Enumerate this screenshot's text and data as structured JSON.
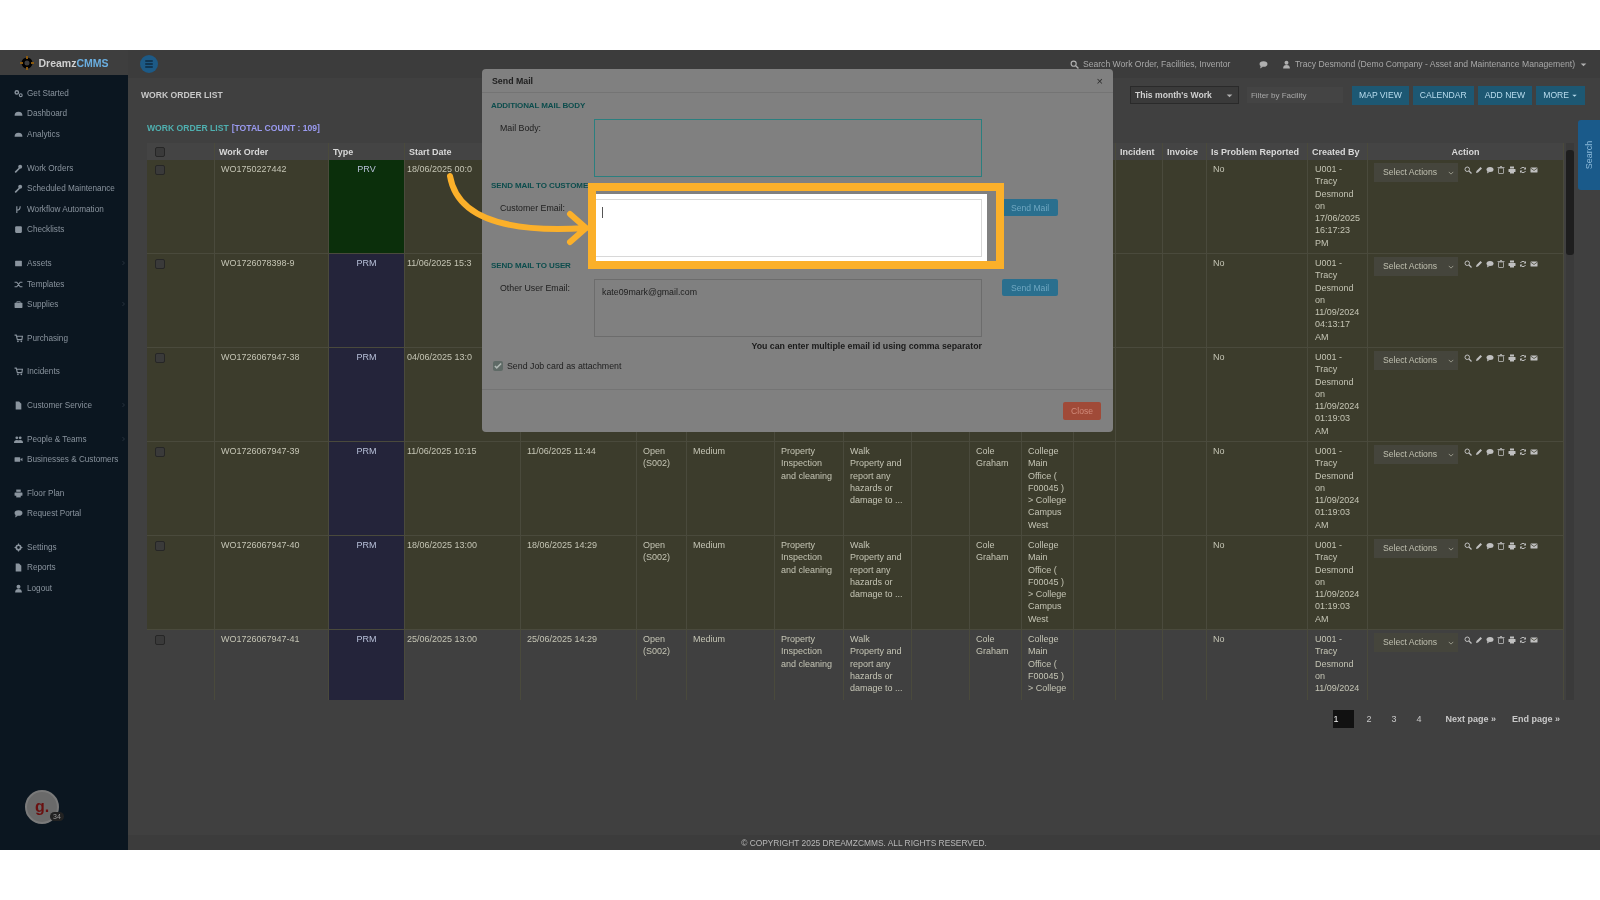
{
  "sidebar": {
    "logo": {
      "name": "Dreamz",
      "suffix": "CMMS"
    },
    "groups": [
      {
        "items": [
          {
            "label": "Get Started",
            "expandable": false
          },
          {
            "label": "Dashboard",
            "expandable": false
          },
          {
            "label": "Analytics",
            "expandable": false
          }
        ]
      },
      {
        "items": [
          {
            "label": "Work Orders",
            "expandable": false
          },
          {
            "label": "Scheduled Maintenance",
            "expandable": false
          },
          {
            "label": "Workflow Automation",
            "expandable": false
          },
          {
            "label": "Checklists",
            "expandable": false
          }
        ]
      },
      {
        "items": [
          {
            "label": "Assets",
            "expandable": true
          },
          {
            "label": "Templates",
            "expandable": false
          },
          {
            "label": "Supplies",
            "expandable": true
          }
        ]
      },
      {
        "items": [
          {
            "label": "Purchasing",
            "expandable": false
          }
        ]
      },
      {
        "items": [
          {
            "label": "Incidents",
            "expandable": false
          }
        ]
      },
      {
        "items": [
          {
            "label": "Customer Service",
            "expandable": true
          }
        ]
      },
      {
        "items": [
          {
            "label": "People & Teams",
            "expandable": true
          },
          {
            "label": "Businesses & Customers",
            "expandable": false
          }
        ]
      },
      {
        "items": [
          {
            "label": "Floor Plan",
            "expandable": false
          },
          {
            "label": "Request Portal",
            "expandable": false
          }
        ]
      },
      {
        "items": [
          {
            "label": "Settings",
            "expandable": false
          },
          {
            "label": "Reports",
            "expandable": false
          },
          {
            "label": "Logout",
            "expandable": false
          }
        ]
      }
    ],
    "avatar": {
      "letter": "g.",
      "badge": "34"
    }
  },
  "header": {
    "search": {
      "placeholder": "Search Work Order, Facilities, Inventor"
    },
    "user": "Tracy Desmond (Demo Company - Asset and Maintenance Management)"
  },
  "toolbar": {
    "title": "WORK ORDER LIST",
    "period": "This month's Work",
    "facility_filter": {
      "placeholder": "Filter by Facility"
    },
    "buttons": [
      {
        "label": "MAP VIEW",
        "kind": "plain"
      },
      {
        "label": "CALENDAR",
        "kind": "plain"
      },
      {
        "label": "ADD NEW",
        "kind": "plain"
      },
      {
        "label": "MORE",
        "kind": "dropdown"
      }
    ]
  },
  "list_title": "WORK ORDER LIST",
  "total_count": "[TOTAL COUNT : 109]",
  "table": {
    "header_checkbox": {
      "checked": false
    },
    "columns": [
      {
        "label": "Work Order"
      },
      {
        "label": "Type"
      },
      {
        "label": "Start Date"
      },
      {
        "label": "Incident"
      },
      {
        "label": "Invoice"
      },
      {
        "label": "Is Problem Reported"
      },
      {
        "label": "Created By"
      },
      {
        "label": "Action"
      }
    ],
    "rows": [
      {
        "checked": false,
        "highlighted": true,
        "work_order": "WO1750227442",
        "type": {
          "label": "PRV",
          "color": "#0b2f0b"
        },
        "start_date": "18/06/2025 00:0",
        "problem_reported": "No",
        "created_by": "U001 - Tracy Desmond on 17/06/2025 16:17:23 PM",
        "action": "Select Actions"
      },
      {
        "checked": false,
        "highlighted": true,
        "work_order": "WO1726078398-9",
        "type": {
          "label": "PRM",
          "color": "#24243a"
        },
        "start_date": "11/06/2025 15:3",
        "problem_reported": "No",
        "created_by": "U001 - Tracy Desmond on 11/09/2024 04:13:17 AM",
        "action": "Select Actions"
      },
      {
        "checked": false,
        "highlighted": true,
        "work_order": "WO1726067947-38",
        "type": {
          "label": "PRM",
          "color": "#24243a"
        },
        "start_date": "04/06/2025 13:0",
        "problem_reported": "No",
        "created_by": "U001 - Tracy Desmond on 11/09/2024 01:19:03 AM",
        "action": "Select Actions"
      },
      {
        "checked": false,
        "highlighted": true,
        "work_order": "WO1726067947-39",
        "type": {
          "label": "PRM",
          "color": "#24243a"
        },
        "start_date": "11/06/2025 10:15",
        "end_date": "11/06/2025 11:44",
        "status": "Open (S002)",
        "priority": "Medium",
        "category": "Property Inspection and cleaning",
        "description": "Walk Property and report any hazards or damage to ...",
        "assigned": "Cole Graham",
        "facility": "College Main Office ( F00045 ) > College Campus West",
        "problem_reported": "No",
        "created_by": "U001 - Tracy Desmond on 11/09/2024 01:19:03 AM",
        "action": "Select Actions"
      },
      {
        "checked": false,
        "highlighted": true,
        "work_order": "WO1726067947-40",
        "type": {
          "label": "PRM",
          "color": "#24243a"
        },
        "start_date": "18/06/2025 13:00",
        "end_date": "18/06/2025 14:29",
        "status": "Open (S002)",
        "priority": "Medium",
        "category": "Property Inspection and cleaning",
        "description": "Walk Property and report any hazards or damage to ...",
        "assigned": "Cole Graham",
        "facility": "College Main Office ( F00045 ) > College Campus West",
        "problem_reported": "No",
        "created_by": "U001 - Tracy Desmond on 11/09/2024 01:19:03 AM",
        "action": "Select Actions"
      },
      {
        "checked": false,
        "highlighted": false,
        "work_order": "WO1726067947-41",
        "type": {
          "label": "PRM",
          "color": "#24243a"
        },
        "start_date": "25/06/2025 13:00",
        "end_date": "25/06/2025 14:29",
        "status": "Open (S002)",
        "priority": "Medium",
        "category": "Property Inspection and cleaning",
        "description": "Walk Property and report any hazards or damage to ...",
        "assigned": "Cole Graham",
        "facility": "College Main Office ( F00045 ) > College",
        "problem_reported": "No",
        "created_by": "U001 - Tracy Desmond on 11/09/2024",
        "action": "Select Actions"
      }
    ]
  },
  "pagination": {
    "pages": [
      {
        "label": "1",
        "selected": true
      },
      {
        "label": "2",
        "selected": false
      },
      {
        "label": "3",
        "selected": false
      },
      {
        "label": "4",
        "selected": false
      }
    ],
    "links": [
      "Next page »",
      "End page »"
    ]
  },
  "search_tab": "Search",
  "footer": "© COPYRIGHT 2025 DREAMZCMMS. ALL RIGHTS RESERVED.",
  "modal": {
    "title": "Send Mail",
    "close_icon": "×",
    "sections": [
      {
        "heading": "ADDITIONAL MAIL BODY",
        "label": "Mail Body:",
        "kind": "body",
        "highlighted": false,
        "focused": false
      },
      {
        "heading": "SEND MAIL TO CUSTOME",
        "label": "Customer Email:",
        "kind": "email",
        "button": "Send Mail",
        "highlighted": true,
        "focused": true
      },
      {
        "heading": "SEND MAIL TO USER",
        "label": "Other User Email:",
        "kind": "email",
        "button": "Send Mail",
        "value": "kate09mark@gmail.com",
        "highlighted": false,
        "focused": false,
        "hint": "You can enter multiple email id using comma separator"
      }
    ],
    "attachment": {
      "label": "Send Job card as attachment",
      "checked": true
    },
    "close_button": "Close"
  }
}
